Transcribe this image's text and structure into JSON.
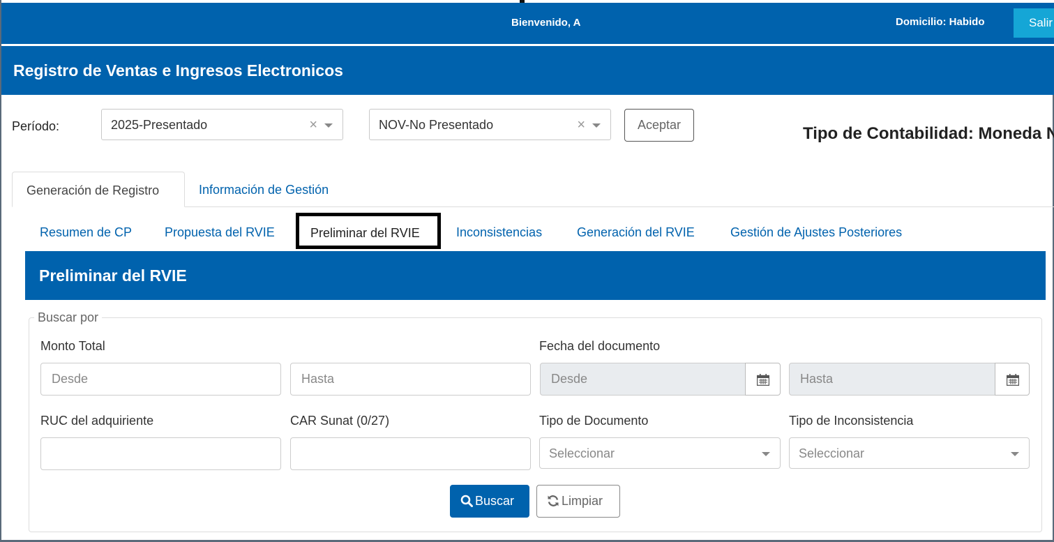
{
  "header": {
    "welcome": "Bienvenido, A",
    "domicilio": "Domicilio: Habido",
    "logout": "Salir"
  },
  "app_title": "Registro de Ventas e Ingresos Electronicos",
  "periodo": {
    "label": "Período:",
    "year_value": "2025-Presentado",
    "month_value": "NOV-No Presentado",
    "clear_glyph": "×",
    "accept": "Aceptar"
  },
  "tipo_contabilidad": "Tipo de Contabilidad: Moneda N",
  "main_tabs": [
    {
      "label": "Generación de Registro",
      "active": true
    },
    {
      "label": "Información de Gestión",
      "active": false
    }
  ],
  "sub_tabs": [
    {
      "label": "Resumen de CP",
      "active": false
    },
    {
      "label": "Propuesta del RVIE",
      "active": false
    },
    {
      "label": "Preliminar del RVIE",
      "active": true
    },
    {
      "label": "Inconsistencias",
      "active": false
    },
    {
      "label": "Generación del RVIE",
      "active": false
    },
    {
      "label": "Gestión de Ajustes Posteriores",
      "active": false
    }
  ],
  "section_title": "Preliminar del RVIE",
  "search": {
    "legend": "Buscar por",
    "monto_total": {
      "label": "Monto Total",
      "desde": "Desde",
      "hasta": "Hasta"
    },
    "fecha_documento": {
      "label": "Fecha del documento",
      "desde": "Desde",
      "hasta": "Hasta"
    },
    "ruc_label": "RUC del adquiriente",
    "car_label": "CAR Sunat (0/27)",
    "tipo_documento": {
      "label": "Tipo de Documento",
      "placeholder": "Seleccionar"
    },
    "tipo_inconsistencia": {
      "label": "Tipo de Inconsistencia",
      "placeholder": "Seleccionar"
    },
    "buscar": "Buscar",
    "limpiar": "Limpiar"
  },
  "icons": {
    "search": "search-icon",
    "refresh": "refresh-icon",
    "calendar": "calendar-icon",
    "dropdown": "chevron-down-icon"
  },
  "colors": {
    "brand_blue": "#0062ad",
    "logout_button": "#15a6d6",
    "disabled_field": "#e9ecef"
  }
}
